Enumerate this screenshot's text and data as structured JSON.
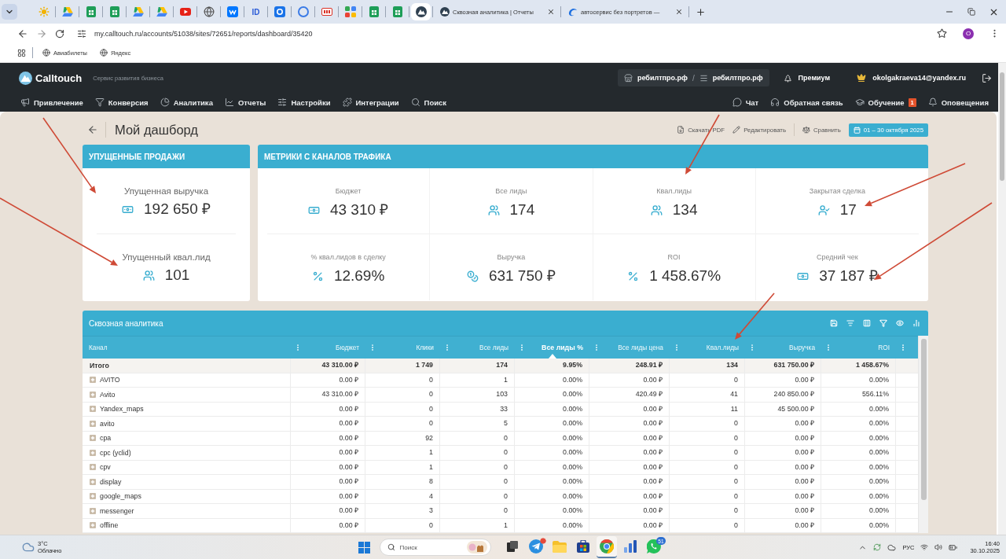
{
  "browser": {
    "pinned_tabs": [
      {
        "kind": "star",
        "selected": false
      },
      {
        "kind": "drive",
        "selected": false
      },
      {
        "kind": "sheets",
        "selected": false
      },
      {
        "kind": "sheets",
        "selected": false
      },
      {
        "kind": "drive",
        "selected": false
      },
      {
        "kind": "drive",
        "selected": false
      },
      {
        "kind": "video",
        "selected": false
      },
      {
        "kind": "globe",
        "selected": false
      },
      {
        "kind": "vk",
        "selected": false
      },
      {
        "kind": "text",
        "label": "ID",
        "selected": false
      },
      {
        "kind": "mail",
        "selected": false
      },
      {
        "kind": "ring",
        "selected": false
      },
      {
        "kind": "mark",
        "selected": false
      },
      {
        "kind": "puzzle",
        "selected": false
      },
      {
        "kind": "sheets",
        "selected": false
      },
      {
        "kind": "sheets",
        "selected": false
      },
      {
        "kind": "logo",
        "selected": true
      }
    ],
    "tabs": [
      {
        "kind": "logo",
        "title": "Сквозная аналитика | Отчеты",
        "selected": false
      },
      {
        "kind": "swoosh",
        "title": "автосервис без портретов —",
        "selected": false
      }
    ],
    "url": "my.calltouch.ru/accounts/51038/sites/72651/reports/dashboard/35420",
    "profile_initial": "O",
    "bookmarks": [
      "Авиабилеты",
      "Яндекс"
    ]
  },
  "app": {
    "logo": "Calltouch",
    "tagline": "Сервис развития бизнеса",
    "sites": [
      {
        "kind": "store",
        "label": "ребилтпро.рф"
      },
      {
        "kind": "list",
        "label": "ребилтпро.рф"
      }
    ],
    "site_separator": "/",
    "plan": "Премиум",
    "user": "okolgakraeva14@yandex.ru",
    "nav": [
      {
        "kind": "megaphone",
        "label": "Привлечение"
      },
      {
        "kind": "funnel",
        "label": "Конверсия"
      },
      {
        "kind": "pie",
        "label": "Аналитика"
      },
      {
        "kind": "line",
        "label": "Отчеты"
      },
      {
        "kind": "sliders",
        "label": "Настройки"
      },
      {
        "kind": "puzzle",
        "label": "Интеграции"
      },
      {
        "kind": "search",
        "label": "Поиск"
      }
    ],
    "nav_right": [
      {
        "kind": "chat",
        "label": "Чат"
      },
      {
        "kind": "headset",
        "label": "Обратная связь"
      },
      {
        "kind": "cap",
        "label": "Обучение",
        "badge": "1"
      },
      {
        "kind": "bell",
        "label": "Оповещения"
      }
    ]
  },
  "dashboard": {
    "title": "Мой дашборд",
    "actions": [
      {
        "kind": "download",
        "label": "Скачать PDF"
      },
      {
        "kind": "pencil",
        "label": "Редактировать"
      },
      {
        "kind": "scale",
        "label": "Сравнить"
      }
    ],
    "date_range": "01 – 30 октября 2025"
  },
  "lost_sales": {
    "title": "УПУЩЕННЫЕ ПРОДАЖИ",
    "metrics": [
      {
        "label": "Упущенная выручка",
        "kind": "money",
        "value": "192 650 ₽"
      },
      {
        "label": "Упущенный квал.лид",
        "kind": "people",
        "value": "101"
      }
    ]
  },
  "traffic_metrics": {
    "title": "МЕТРИКИ С КАНАЛОВ ТРАФИКА",
    "metrics": [
      {
        "label": "Бюджет",
        "kind": "money",
        "value": "43 310 ₽"
      },
      {
        "label": "Все лиды",
        "kind": "people",
        "value": "174"
      },
      {
        "label": "Квал.лиды",
        "kind": "people",
        "value": "134"
      },
      {
        "label": "Закрытая сделка",
        "kind": "deal",
        "value": "17"
      },
      {
        "label": "% квал.лидов в сделку",
        "kind": "percent",
        "value": "12.69%"
      },
      {
        "label": "Выручка",
        "kind": "revenue",
        "value": "631 750 ₽"
      },
      {
        "label": "ROI",
        "kind": "percent",
        "value": "1 458.67%"
      },
      {
        "label": "Средний чек",
        "kind": "money",
        "value": "37 187 ₽"
      }
    ]
  },
  "table": {
    "title": "Сквозная аналитика",
    "columns": [
      {
        "label": "Канал",
        "sorted": false
      },
      {
        "label": "Бюджет",
        "sorted": false
      },
      {
        "label": "Клики",
        "sorted": false
      },
      {
        "label": "Все лиды",
        "sorted": false
      },
      {
        "label": "Все лиды %",
        "sorted": true
      },
      {
        "label": "Все лиды цена",
        "sorted": false
      },
      {
        "label": "Квал.лиды",
        "sorted": false
      },
      {
        "label": "Выручка",
        "sorted": false
      },
      {
        "label": "ROI",
        "sorted": false
      }
    ],
    "total": {
      "cells": [
        "Итого",
        "43 310.00 ₽",
        "1 749",
        "174",
        "9.95%",
        "248.91 ₽",
        "134",
        "631 750.00 ₽",
        "1 458.67%"
      ]
    },
    "rows": [
      {
        "cells": [
          "AVITO",
          "0.00 ₽",
          "0",
          "1",
          "0.00%",
          "0.00 ₽",
          "0",
          "0.00 ₽",
          "0.00%"
        ]
      },
      {
        "cells": [
          "Avito",
          "43 310.00 ₽",
          "0",
          "103",
          "0.00%",
          "420.49 ₽",
          "41",
          "240 850.00 ₽",
          "556.11%"
        ]
      },
      {
        "cells": [
          "Yandex_maps",
          "0.00 ₽",
          "0",
          "33",
          "0.00%",
          "0.00 ₽",
          "11",
          "45 500.00 ₽",
          "0.00%"
        ]
      },
      {
        "cells": [
          "avito",
          "0.00 ₽",
          "0",
          "5",
          "0.00%",
          "0.00 ₽",
          "0",
          "0.00 ₽",
          "0.00%"
        ]
      },
      {
        "cells": [
          "cpa",
          "0.00 ₽",
          "92",
          "0",
          "0.00%",
          "0.00 ₽",
          "0",
          "0.00 ₽",
          "0.00%"
        ]
      },
      {
        "cells": [
          "cpc (yclid)",
          "0.00 ₽",
          "1",
          "0",
          "0.00%",
          "0.00 ₽",
          "0",
          "0.00 ₽",
          "0.00%"
        ]
      },
      {
        "cells": [
          "cpv",
          "0.00 ₽",
          "1",
          "0",
          "0.00%",
          "0.00 ₽",
          "0",
          "0.00 ₽",
          "0.00%"
        ]
      },
      {
        "cells": [
          "display",
          "0.00 ₽",
          "8",
          "0",
          "0.00%",
          "0.00 ₽",
          "0",
          "0.00 ₽",
          "0.00%"
        ]
      },
      {
        "cells": [
          "google_maps",
          "0.00 ₽",
          "4",
          "0",
          "0.00%",
          "0.00 ₽",
          "0",
          "0.00 ₽",
          "0.00%"
        ]
      },
      {
        "cells": [
          "messenger",
          "0.00 ₽",
          "3",
          "0",
          "0.00%",
          "0.00 ₽",
          "0",
          "0.00 ₽",
          "0.00%"
        ]
      },
      {
        "cells": [
          "offline",
          "0.00 ₽",
          "0",
          "1",
          "0.00%",
          "0.00 ₽",
          "0",
          "0.00 ₽",
          "0.00%"
        ]
      }
    ]
  },
  "annotations": [
    {
      "kind": "arrow"
    },
    {
      "kind": "arrow"
    },
    {
      "kind": "arrow"
    },
    {
      "kind": "arrow"
    },
    {
      "kind": "arrow"
    },
    {
      "kind": "arrow"
    }
  ],
  "taskbar": {
    "weather": {
      "temp": "3°C",
      "condition": "Облачно"
    },
    "search": {
      "placeholder": "Поиск"
    },
    "apps": [
      {
        "kind": "taskview",
        "active": false
      },
      {
        "kind": "plane",
        "active": false,
        "notification": true
      },
      {
        "kind": "folder",
        "active": false
      },
      {
        "kind": "store",
        "active": false
      },
      {
        "kind": "browser",
        "active": true
      },
      {
        "kind": "chart",
        "active": false
      },
      {
        "kind": "chat",
        "active": false,
        "badge": "51"
      }
    ],
    "language": "РУС",
    "time": "16:40",
    "date": "30.10.2025"
  }
}
